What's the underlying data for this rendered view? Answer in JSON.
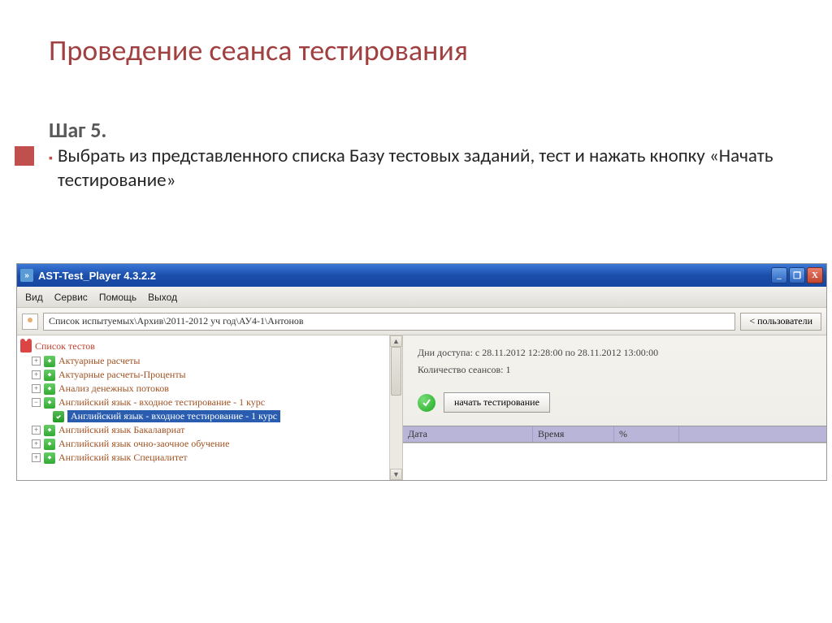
{
  "slide": {
    "title": "Проведение сеанса тестирования",
    "step_heading": "Шаг 5.",
    "step_text": "Выбрать из представленного списка Базу тестовых заданий, тест и нажать кнопку «Начать тестирование»"
  },
  "window": {
    "title": "AST-Test_Player  4.3.2.2",
    "buttons": {
      "min": "_",
      "max": "❐",
      "close": "X"
    }
  },
  "menu": {
    "view": "Вид",
    "service": "Сервис",
    "help": "Помощь",
    "exit": "Выход"
  },
  "pathbar": {
    "value": "Список испытуемых\\Архив\\2011-2012 уч год\\АУ4-1\\Антонов",
    "users_btn": "<  пользователи"
  },
  "tree": {
    "root": "Список тестов",
    "items": [
      {
        "exp": "+",
        "label": "Актуарные расчеты"
      },
      {
        "exp": "+",
        "label": "Актуарные расчеты-Проценты"
      },
      {
        "exp": "+",
        "label": "Анализ денежных потоков"
      },
      {
        "exp": "−",
        "label": "Английский язык - входное тестирование - 1 курс"
      },
      {
        "exp": "",
        "label": "Английский язык - входное тестирование - 1 курс",
        "indent": 2,
        "selected": true
      },
      {
        "exp": "+",
        "label": "Английский язык Бакалавриат"
      },
      {
        "exp": "+",
        "label": "Английский язык очно-заочное обучение"
      },
      {
        "exp": "+",
        "label": "Английский язык Специалитет"
      }
    ]
  },
  "right": {
    "access_line": "Дни доступа:  с 28.11.2012 12:28:00 по 28.11.2012 13:00:00",
    "sessions_line": "Количество сеансов: 1",
    "start_label": "начать тестирование",
    "cols": {
      "date": "Дата",
      "time": "Время",
      "pct": "%"
    }
  }
}
